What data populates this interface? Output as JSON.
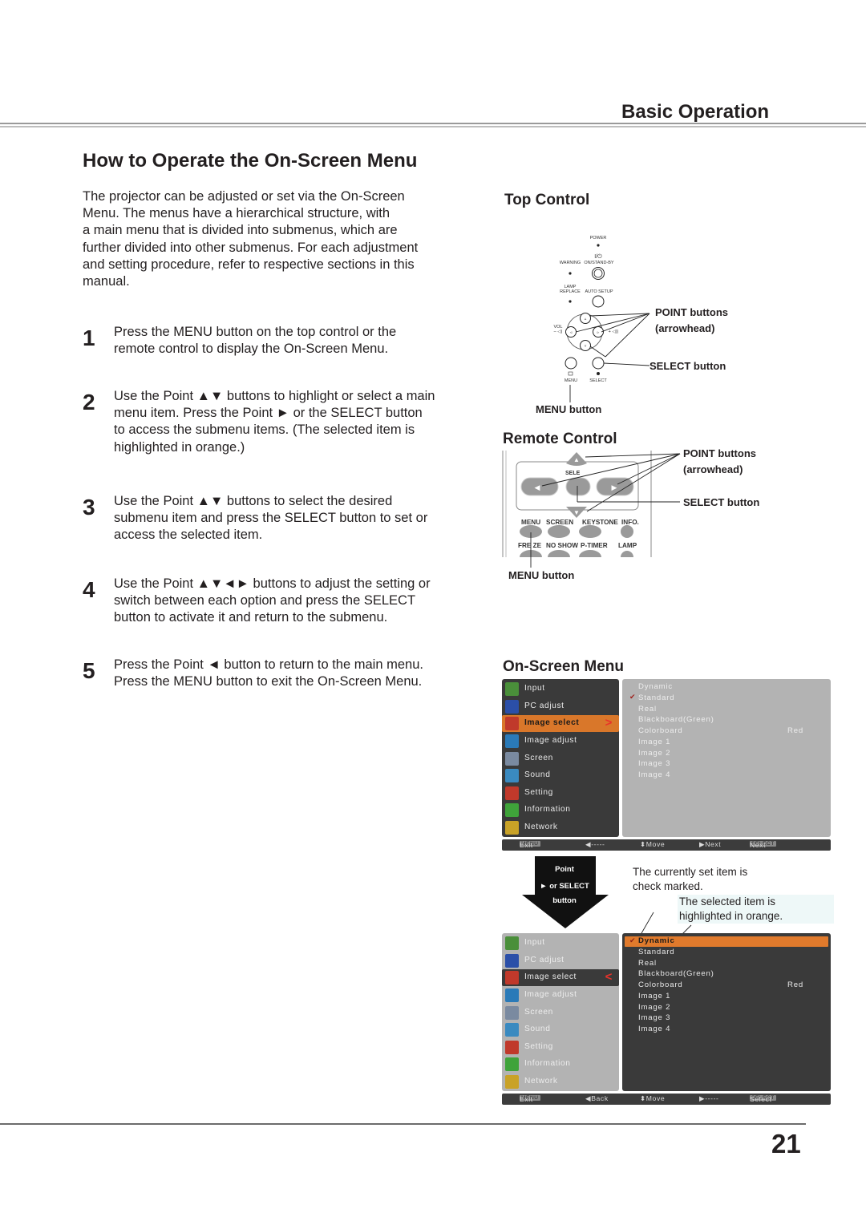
{
  "header": {
    "section_title": "Basic Operation",
    "page_heading": "How to Operate the On-Screen Menu"
  },
  "intro_lines": [
    "The projector can be adjusted or set via the On-Screen",
    "Menu. The menus have a hierarchical structure, with",
    "a main menu that is divided into submenus, which are",
    "further divided into other submenus. For each adjustment",
    "and setting procedure, refer to respective sections in this",
    "manual."
  ],
  "steps": [
    {
      "number": "1",
      "lines": [
        "Press the MENU button on the top control or the",
        "remote control to display the On-Screen Menu."
      ]
    },
    {
      "number": "2",
      "lines": [
        "Use the Point ▲▼ buttons to highlight or select a main",
        "menu item. Press the Point ► or the SELECT button",
        "to access the submenu items. (The selected item is",
        "highlighted in orange.)"
      ]
    },
    {
      "number": "3",
      "lines": [
        "Use the Point ▲▼ buttons to select the desired",
        "submenu item and press the SELECT button to set or",
        "access the selected item."
      ]
    },
    {
      "number": "4",
      "lines": [
        "Use the Point ▲▼◄► buttons to adjust the setting or",
        "switch between each option and press the SELECT",
        "button to activate it and return to the submenu."
      ]
    },
    {
      "number": "5",
      "lines": [
        "Press the Point ◄ button to return to the main menu.",
        "Press the MENU button to exit the On-Screen Menu."
      ]
    }
  ],
  "top_control": {
    "title": "Top Control",
    "labels": {
      "power": "POWER",
      "on_standby_symbol": "I/⏻",
      "warning": "WARNING",
      "on_standby": "ON/STAND-BY",
      "lamp": "LAMP",
      "replace": "REPLACE",
      "auto_setup": "AUTO SETUP",
      "vol": "VOL",
      "vol_minus": "– ◁)",
      "vol_plus": "+ ◁))",
      "menu": "MENU",
      "select": "SELECT"
    },
    "callouts": {
      "point_buttons": "POINT buttons",
      "arrowhead": "(arrowhead)",
      "select_button": "SELECT button",
      "menu_button": "MENU button"
    }
  },
  "remote_control": {
    "title": "Remote Control",
    "key_labels_row1": [
      "MENU",
      "SCREEN",
      "KEYSTONE",
      "INFO."
    ],
    "key_labels_row2": [
      "FRE  ZE",
      "NO SHOW",
      "P-TIMER",
      "LAMP"
    ],
    "select_partial": "SELE",
    "callouts": {
      "point_buttons": "POINT buttons",
      "arrowhead": "(arrowhead)",
      "select_button": "SELECT button",
      "menu_button": "MENU button"
    }
  },
  "osd": {
    "title": "On-Screen Menu",
    "main_menu": [
      {
        "label": "Input",
        "icon": "input-icon",
        "color": "#4a8f3a"
      },
      {
        "label": "PC adjust",
        "icon": "pc-adjust-icon",
        "color": "#2b4fa8"
      },
      {
        "label": "Image select",
        "icon": "image-select-icon",
        "color": "#c0392b"
      },
      {
        "label": "Image adjust",
        "icon": "image-adjust-icon",
        "color": "#2a7ab8"
      },
      {
        "label": "Screen",
        "icon": "screen-icon",
        "color": "#7a8aa0"
      },
      {
        "label": "Sound",
        "icon": "sound-icon",
        "color": "#3a8ac0"
      },
      {
        "label": "Setting",
        "icon": "setting-icon",
        "color": "#c0392b"
      },
      {
        "label": "Information",
        "icon": "information-icon",
        "color": "#3fa33a"
      },
      {
        "label": "Network",
        "icon": "network-icon",
        "color": "#c9a227"
      }
    ],
    "selected_main_index": 2,
    "submenu": [
      "Dynamic",
      "Standard",
      "Real",
      "Blackboard(Green)",
      "Colorboard",
      "Image 1",
      "Image 2",
      "Image 3",
      "Image 4"
    ],
    "colorboard_value": "Red",
    "screen1": {
      "checked_index": 1,
      "arrow_glyph": ">",
      "status_bar": {
        "menu_key": "MENU",
        "exit": "Exit",
        "left": "◀-----",
        "move": "⬍Move",
        "right": "▶Next",
        "select_key": "SELECT",
        "select_action": "Next"
      }
    },
    "screen2": {
      "checked_index": 0,
      "highlighted_index": 0,
      "arrow_glyph": "<",
      "status_bar": {
        "menu_key": "MENU",
        "exit": "Exit",
        "left": "◀Back",
        "move": "⬍Move",
        "right": "▶-----",
        "select_key": "SELECT",
        "select_action": "Select"
      }
    },
    "transition_arrow": {
      "line1": "Point",
      "line2": "► or SELECT",
      "line3": "button"
    },
    "notes": {
      "check_marked": [
        "The currently set item is",
        "check marked."
      ],
      "highlighted": [
        "The selected item is",
        "highlighted in orange."
      ]
    },
    "colors": {
      "highlight": "#d9772a",
      "panel_dark": "#3a3a3a",
      "panel_light": "#b3b3b3",
      "check": "#a01f1a"
    }
  },
  "footer": {
    "page_number": "21"
  }
}
